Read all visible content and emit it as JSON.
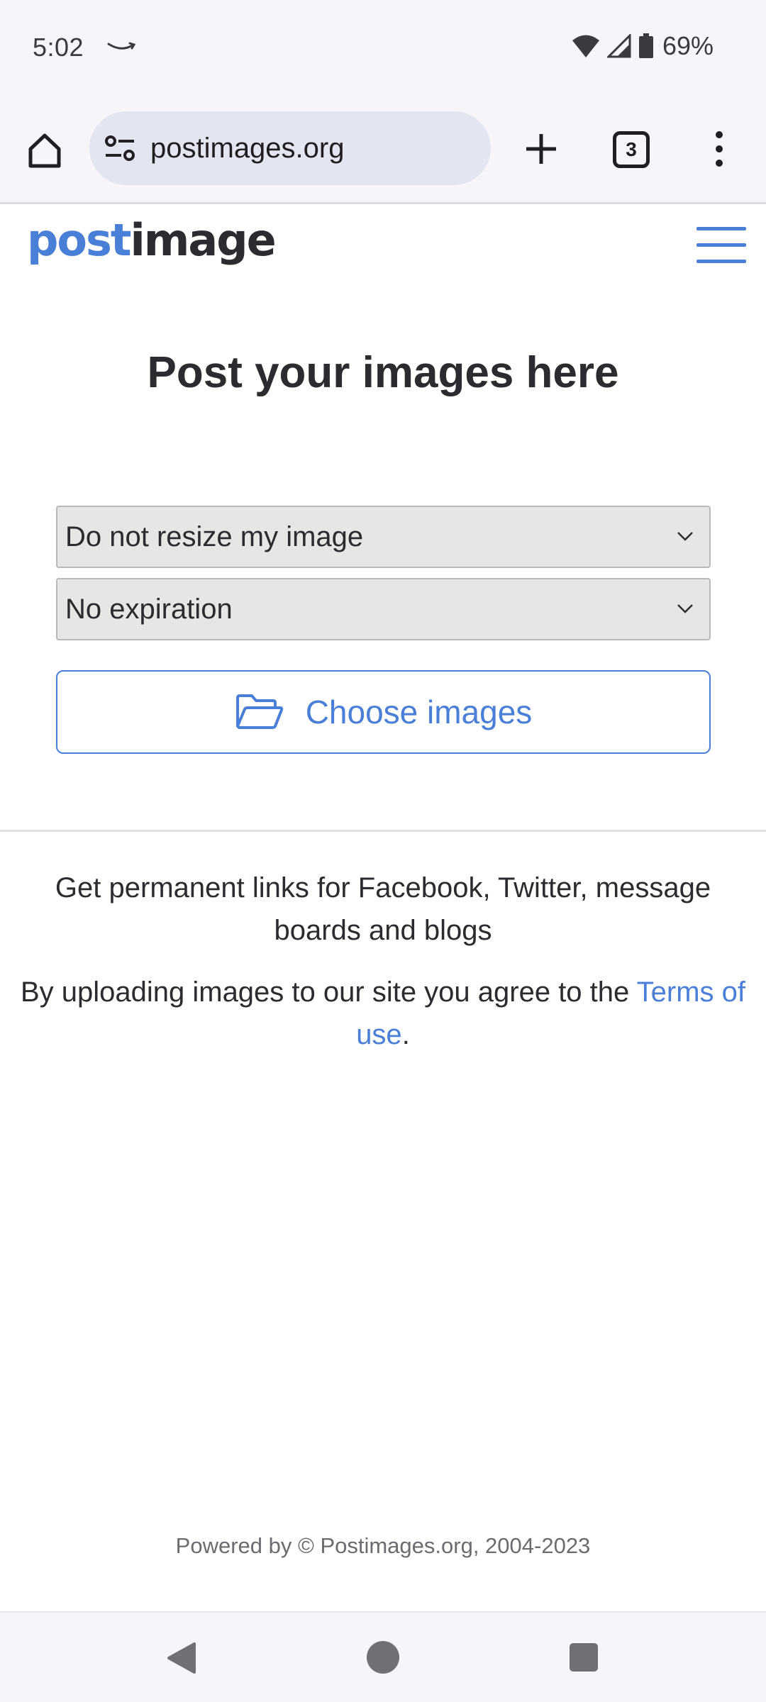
{
  "status_bar": {
    "time": "5:02",
    "battery": "69%"
  },
  "browser": {
    "url": "postimages.org",
    "tab_count": "3"
  },
  "header": {
    "logo_post": "post",
    "logo_image": "image"
  },
  "main": {
    "title": "Post your images here",
    "resize_select": "Do not resize my image",
    "expiration_select": "No expiration",
    "choose_button": "Choose images"
  },
  "info": {
    "tagline": "Get permanent links for Facebook, Twitter, message boards and blogs",
    "terms_prefix": "By uploading images to our site you agree to the ",
    "terms_link": "Terms of use",
    "terms_suffix": "."
  },
  "footer": {
    "text": "Powered by © Postimages.org, 2004-2023"
  },
  "colors": {
    "accent": "#4a7fd8",
    "text": "#2b2b30",
    "chrome": "#f6f5fa"
  }
}
